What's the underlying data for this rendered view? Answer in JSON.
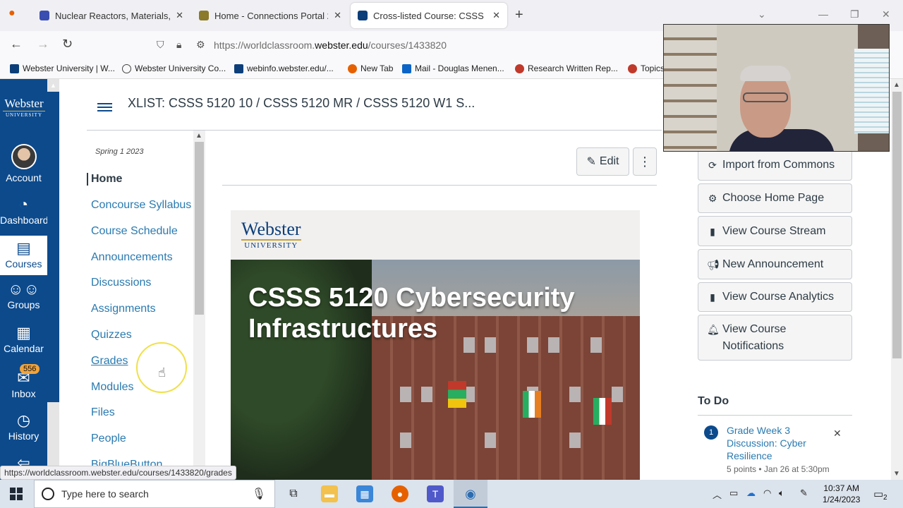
{
  "browser": {
    "tabs": [
      {
        "title": "Nuclear Reactors, Materials, and",
        "favicon_color": "#3a4db0"
      },
      {
        "title": "Home - Connections Portal 2.0",
        "favicon_color": "#8a7a2a"
      },
      {
        "title": "Cross-listed Course: CSSS 5120",
        "favicon_color": "#0c3f7a"
      }
    ],
    "new_tab": "+",
    "url_prefix": "https://worldclassroom.",
    "url_domain": "webster.edu",
    "url_path": "/courses/1433820",
    "bookmarks": [
      "Webster University | W...",
      "Webster University Co...",
      "webinfo.webster.edu/...",
      "New Tab",
      "Mail - Douglas Menen...",
      "Research Written Rep...",
      "Topics"
    ],
    "status_url": "https://worldclassroom.webster.edu/courses/1433820/grades"
  },
  "global_nav": {
    "logo_word": "Webster",
    "logo_sub": "UNIVERSITY",
    "items": [
      {
        "label": "Account"
      },
      {
        "label": "Dashboard"
      },
      {
        "label": "Courses"
      },
      {
        "label": "Groups"
      },
      {
        "label": "Calendar"
      },
      {
        "label": "Inbox",
        "badge": "556"
      },
      {
        "label": "History"
      }
    ]
  },
  "header": {
    "breadcrumb": "XLIST: CSSS 5120 10 / CSSS 5120 MR / CSSS 5120 W1 S..."
  },
  "course_nav": {
    "term": "Spring 1 2023",
    "items": [
      "Home",
      "Concourse Syllabus",
      "Course Schedule",
      "Announcements",
      "Discussions",
      "Assignments",
      "Quizzes",
      "Grades",
      "Modules",
      "Files",
      "People",
      "BigBlueButton"
    ]
  },
  "main": {
    "edit_label": "Edit",
    "more_label": "⋮",
    "banner_logo_word": "Webster",
    "banner_logo_sub": "UNIVERSITY",
    "hero_title": "CSSS 5120 Cybersecurity Infrastructures"
  },
  "sidebar": {
    "buttons": [
      {
        "label": "Import from Commons",
        "icon": "commons-icon"
      },
      {
        "label": "Choose Home Page",
        "icon": "home-settings-icon"
      },
      {
        "label": "View Course Stream",
        "icon": "bar-chart-icon"
      },
      {
        "label": "New Announcement",
        "icon": "megaphone-icon"
      },
      {
        "label": "View Course Analytics",
        "icon": "bar-chart-icon"
      },
      {
        "label": "View Course Notifications",
        "icon": "bell-icon"
      }
    ],
    "todo": {
      "heading": "To Do",
      "items": [
        {
          "count": "1",
          "title": "Grade Week 3 Discussion: Cyber Resilience",
          "meta": "5 points • Jan 26 at 5:30pm"
        }
      ]
    }
  },
  "taskbar": {
    "search_placeholder": "Type here to search",
    "time": "10:37 AM",
    "date": "1/24/2023",
    "notifications": "2"
  }
}
